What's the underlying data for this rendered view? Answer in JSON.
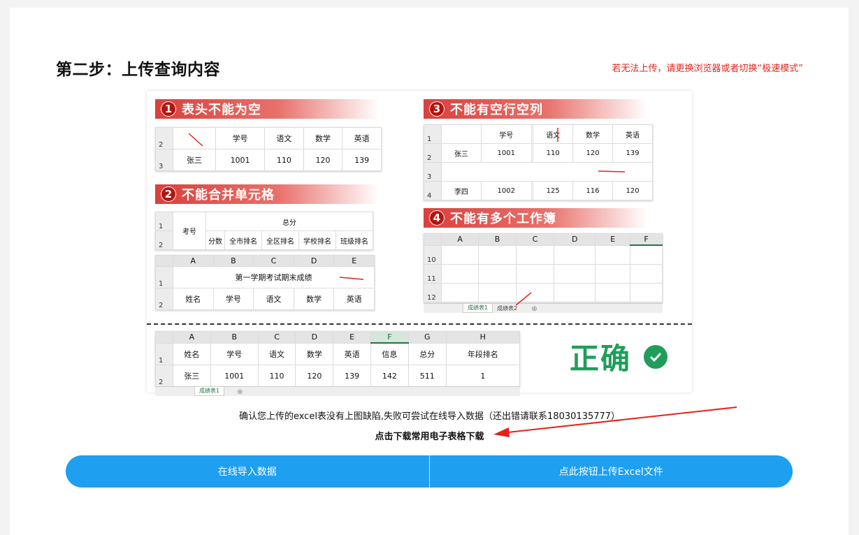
{
  "step_title": "第二步：上传查询内容",
  "browser_hint": "若无法上传，请更换浏览器或者切换“极速模式”",
  "figure": {
    "rule1": {
      "num": "1",
      "title": "表头不能为空",
      "rows": [
        "2",
        "3"
      ],
      "headers": [
        "学号",
        "语文",
        "数学",
        "英语"
      ],
      "values": [
        "张三",
        "1001",
        "110",
        "120",
        "139"
      ]
    },
    "rule2": {
      "num": "2",
      "title": "不能合并单元格",
      "top": {
        "rows": [
          "1",
          "2"
        ],
        "exam": "考号",
        "total": "总分",
        "subs": [
          "分数",
          "全市排名",
          "全区排名",
          "学校排名",
          "班级排名"
        ]
      },
      "bottom": {
        "cols": [
          "A",
          "B",
          "C",
          "D",
          "E"
        ],
        "rows": [
          "1",
          "2"
        ],
        "merged": "第一学期考试期末成绩",
        "headers": [
          "姓名",
          "学号",
          "语文",
          "数学",
          "英语"
        ]
      }
    },
    "rule3": {
      "num": "3",
      "title": "不能有空行空列",
      "rows": [
        "1",
        "2",
        "3",
        "4"
      ],
      "headers": [
        "学号",
        "",
        "语文",
        "数学",
        "英语"
      ],
      "r2": [
        "张三",
        "1001",
        "",
        "110",
        "120",
        "139"
      ],
      "r4": [
        "李四",
        "1002",
        "",
        "125",
        "116",
        "120"
      ]
    },
    "rule4": {
      "num": "4",
      "title": "不能有多个工作簿",
      "cols": [
        "A",
        "B",
        "C",
        "D",
        "E",
        "F"
      ],
      "rows": [
        "10",
        "11",
        "12"
      ],
      "tabs": [
        "成绩表1",
        "成绩表2"
      ]
    },
    "correct": {
      "cols": [
        "A",
        "B",
        "C",
        "D",
        "E",
        "F",
        "G",
        "H"
      ],
      "rows": [
        "1",
        "2"
      ],
      "headers": [
        "姓名",
        "学号",
        "语文",
        "数学",
        "英语",
        "信息",
        "总分",
        "年段排名"
      ],
      "values": [
        "张三",
        "1001",
        "110",
        "120",
        "139",
        "142",
        "511",
        "1"
      ],
      "tab": "成绩表1",
      "label": "正确"
    }
  },
  "confirm_note": "确认您上传的excel表没有上图缺陷,失败可尝试在线导入数据（还出错请联系18030135777）",
  "download_link": "点击下载常用电子表格下载",
  "buttons": {
    "online_import": "在线导入数据",
    "upload_excel": "点此按钮上传Excel文件"
  },
  "colors": {
    "accent": "#1e9ff0",
    "hint": "#e0251d",
    "correct": "#1e9e5a",
    "banner": "#d9403c"
  }
}
